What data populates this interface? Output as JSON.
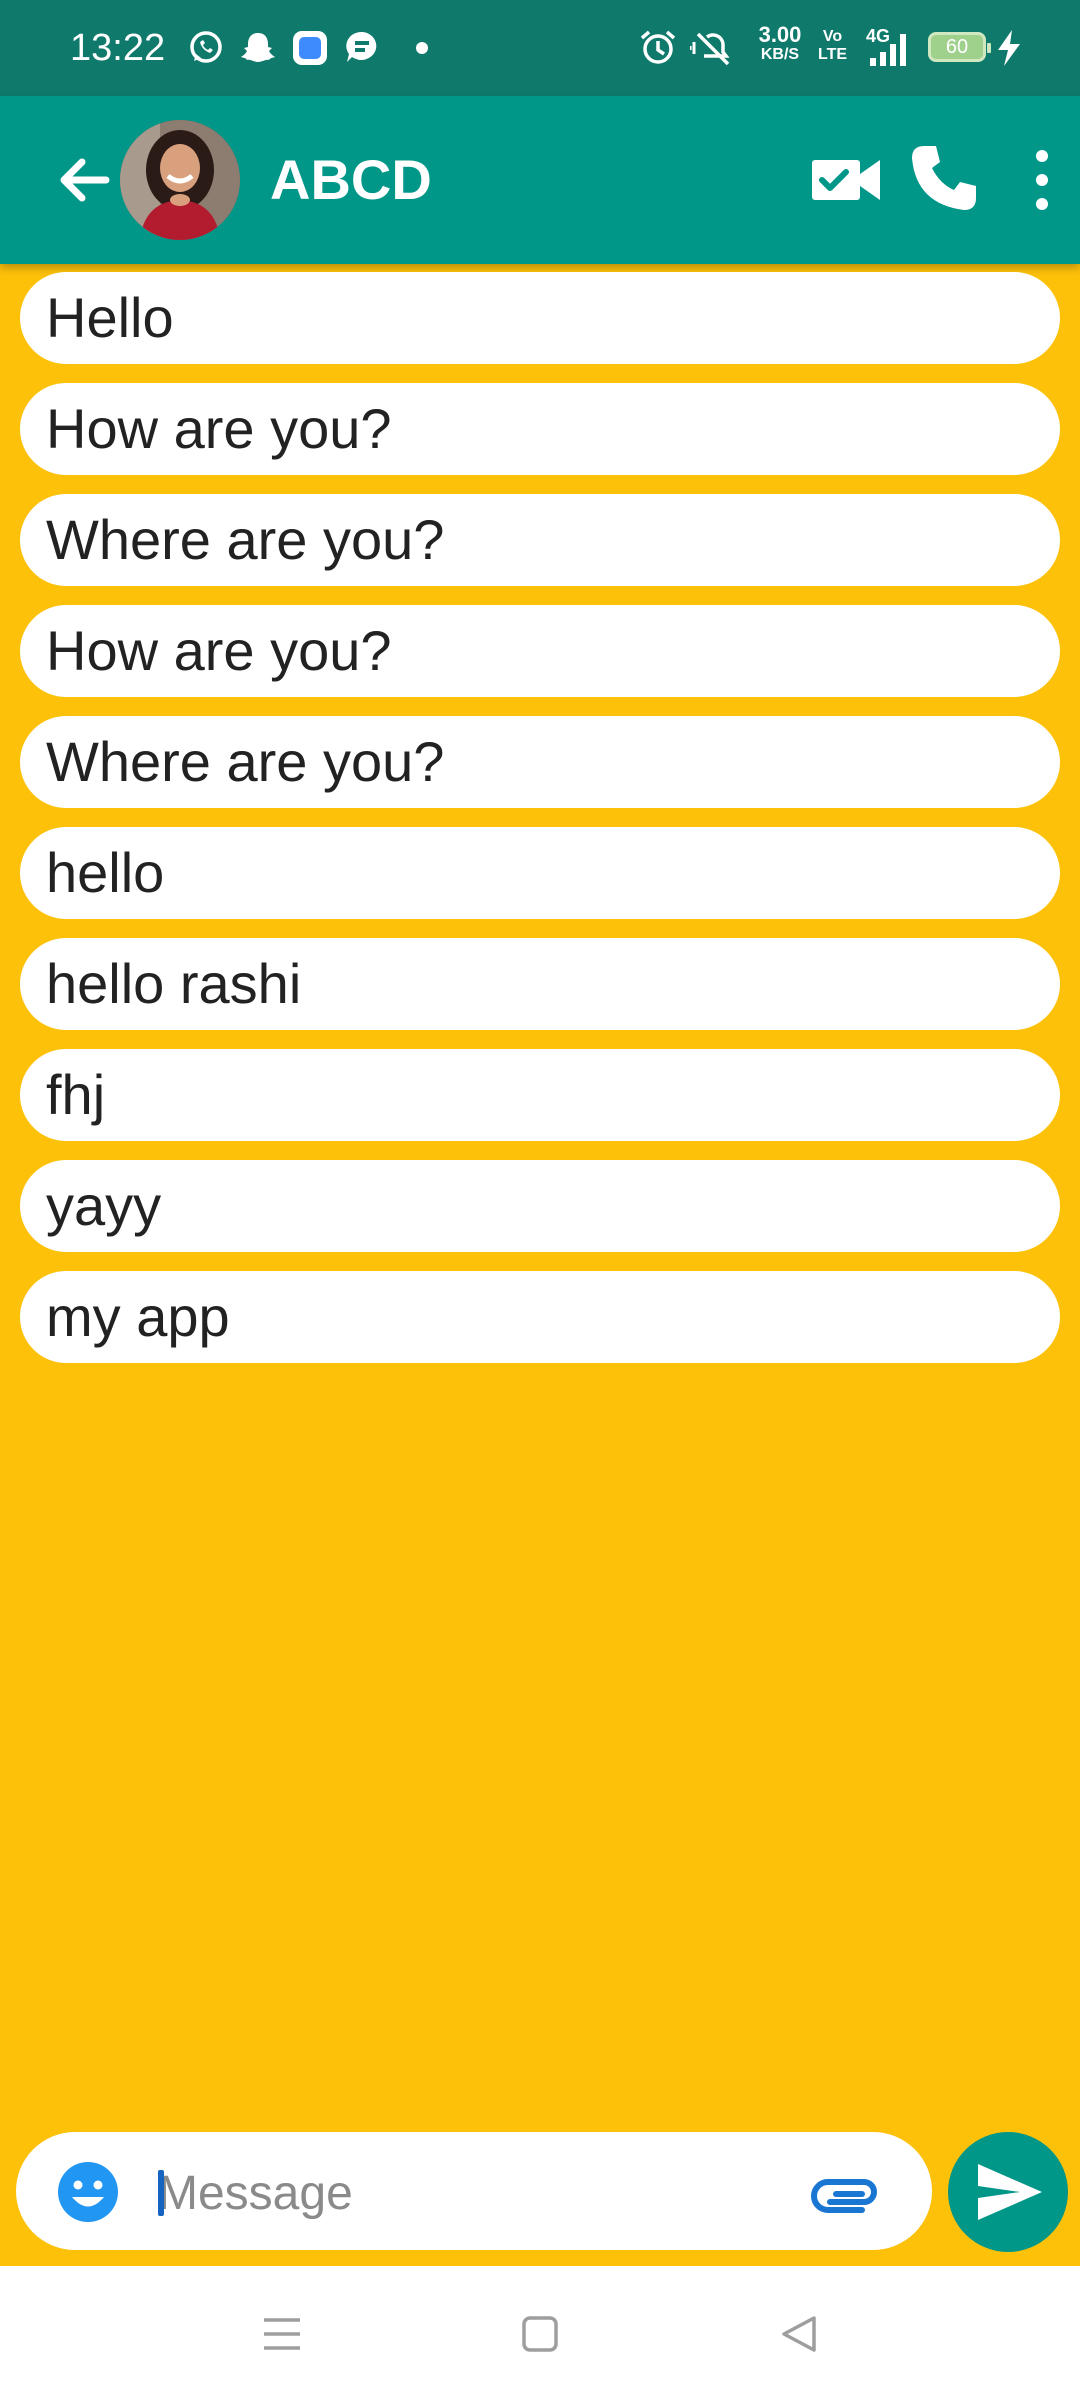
{
  "status_bar": {
    "time": "13:22",
    "net_speed_value": "3.00",
    "net_speed_unit": "KB/S",
    "volte": "Vo\nLTE",
    "network": "4G",
    "battery_level": "60",
    "icons": [
      "whatsapp-icon",
      "snapchat-icon",
      "app-icon",
      "chat-icon",
      "dot-icon",
      "alarm-icon",
      "mute-icon",
      "signal-icon",
      "battery-icon",
      "charging-icon"
    ]
  },
  "header": {
    "back_icon": "arrow-left-icon",
    "contact_name": "ABCD",
    "actions": [
      "video-call-icon",
      "phone-call-icon",
      "more-vert-icon"
    ]
  },
  "messages": [
    "Hello",
    "How are you?",
    "Where are you?",
    "How are you?",
    "Where are you?",
    "hello",
    "hello rashi",
    "fhj",
    "yayy",
    "my app"
  ],
  "composer": {
    "placeholder": "Message",
    "value": "",
    "emoji_icon": "emoji-icon",
    "attach_icon": "attach-icon",
    "send_icon": "send-icon"
  },
  "nav": {
    "items": [
      "menu-icon",
      "home-icon",
      "back-triangle-icon"
    ]
  },
  "colors": {
    "status_bar": "#0F7A6C",
    "app_bar": "#009688",
    "background": "#FDC10A",
    "bubble": "#FFFFFF",
    "emoji": "#2196F3",
    "attach": "#1976D2"
  }
}
